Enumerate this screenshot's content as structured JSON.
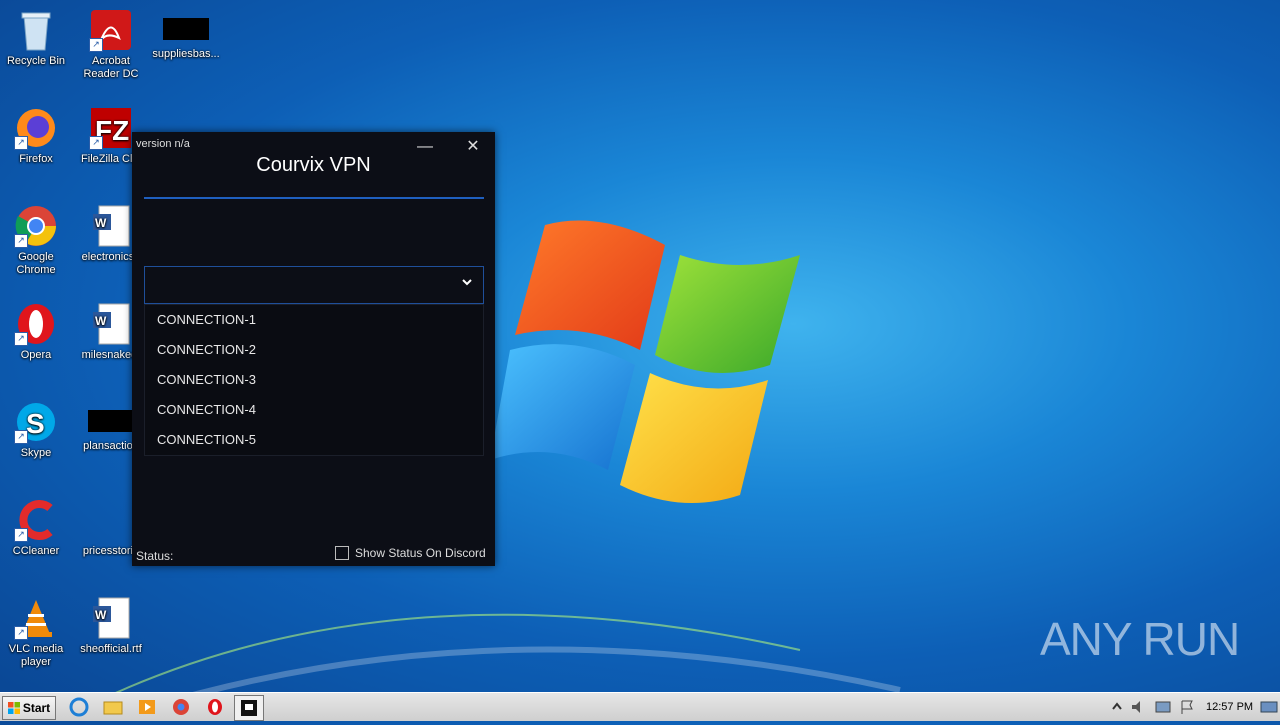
{
  "desktop": {
    "icons": [
      {
        "label": "Recycle Bin"
      },
      {
        "label": "Acrobat Reader DC"
      },
      {
        "label": "suppliesbas..."
      },
      {
        "label": "Firefox"
      },
      {
        "label": "FileZilla Clie"
      },
      {
        "label": "Google Chrome"
      },
      {
        "label": "electronicsb"
      },
      {
        "label": "Opera"
      },
      {
        "label": "milesnaked."
      },
      {
        "label": "Skype"
      },
      {
        "label": "plansaction"
      },
      {
        "label": "CCleaner"
      },
      {
        "label": "pricesstorie"
      },
      {
        "label": "VLC media player"
      },
      {
        "label": "sheofficial.rtf"
      }
    ]
  },
  "vpn_window": {
    "version": "version n/a",
    "title": "Courvix VPN",
    "minimize_glyph": "—",
    "close_glyph": "✕",
    "select_value": "",
    "options": [
      "CONNECTION-1",
      "CONNECTION-2",
      "CONNECTION-3",
      "CONNECTION-4",
      "CONNECTION-5"
    ],
    "status_label": "Status:",
    "discord_label": "Show Status On Discord",
    "discord_checked": false
  },
  "watermark": "ANY RUN",
  "taskbar": {
    "start_label": "Start",
    "clock": "12:57 PM"
  }
}
